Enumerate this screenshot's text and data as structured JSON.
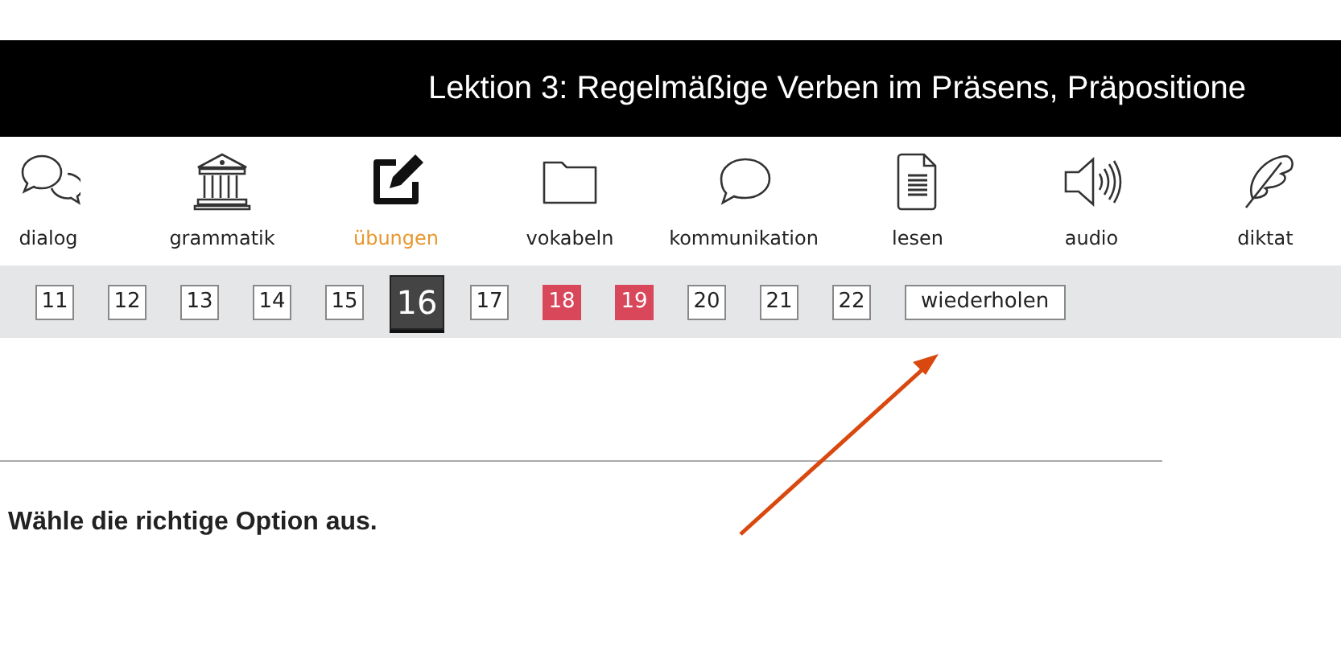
{
  "header": {
    "title": "Lektion 3: Regelmäßige Verben im Präsens, Präpositione"
  },
  "sections": [
    {
      "label": "dialog",
      "selected": false
    },
    {
      "label": "grammatik",
      "selected": false
    },
    {
      "label": "übungen",
      "selected": true
    },
    {
      "label": "vokabeln",
      "selected": false
    },
    {
      "label": "kommunikation",
      "selected": false
    },
    {
      "label": "lesen",
      "selected": false
    },
    {
      "label": "audio",
      "selected": false
    },
    {
      "label": "diktat",
      "selected": false
    }
  ],
  "pages": [
    {
      "label": "11",
      "selected": false,
      "marked": false
    },
    {
      "label": "12",
      "selected": false,
      "marked": false
    },
    {
      "label": "13",
      "selected": false,
      "marked": false
    },
    {
      "label": "14",
      "selected": false,
      "marked": false
    },
    {
      "label": "15",
      "selected": false,
      "marked": false
    },
    {
      "label": "16",
      "selected": true,
      "marked": false
    },
    {
      "label": "17",
      "selected": false,
      "marked": false
    },
    {
      "label": "18",
      "selected": false,
      "marked": true
    },
    {
      "label": "19",
      "selected": false,
      "marked": true
    },
    {
      "label": "20",
      "selected": false,
      "marked": false
    },
    {
      "label": "21",
      "selected": false,
      "marked": false
    },
    {
      "label": "22",
      "selected": false,
      "marked": false
    }
  ],
  "repeat_button": "wiederholen",
  "instruction": "Wähle die richtige Option aus."
}
